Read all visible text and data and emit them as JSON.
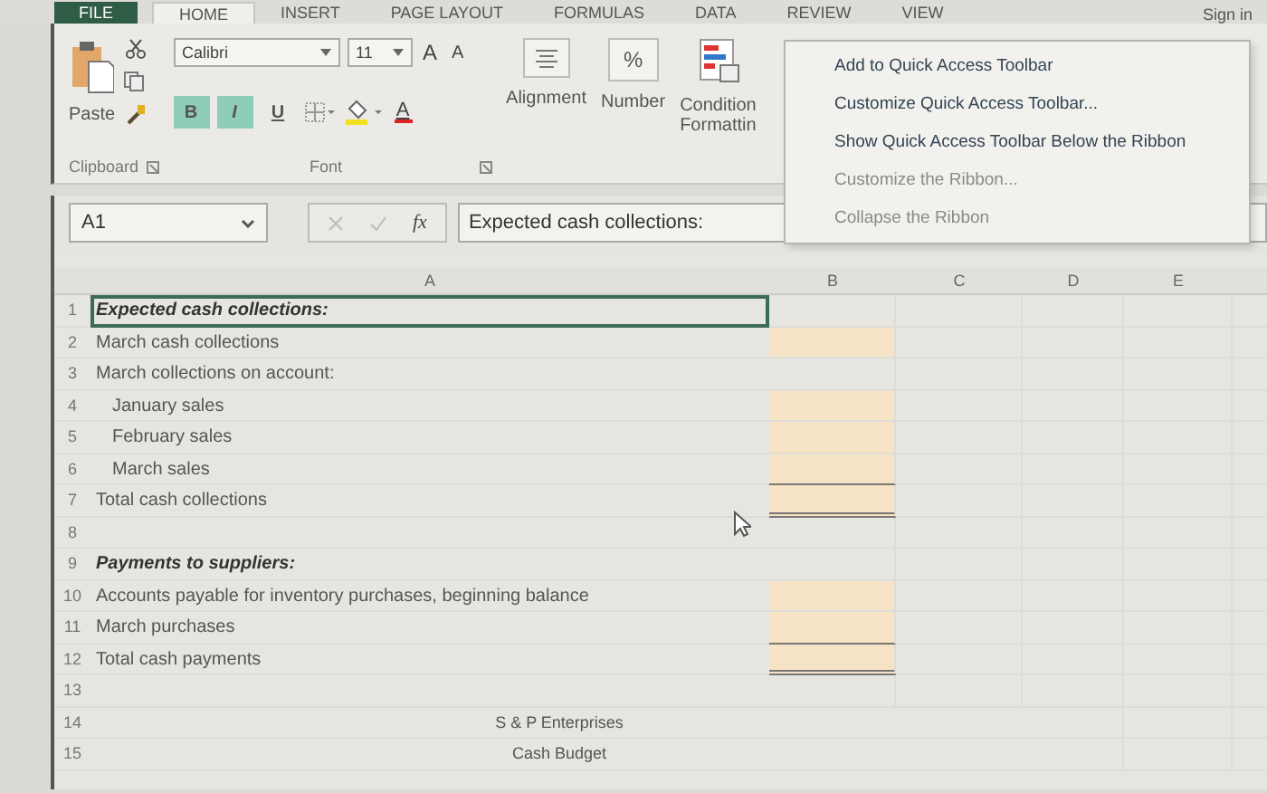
{
  "tabs": [
    {
      "label": "FILE",
      "kind": "file",
      "selected": false
    },
    {
      "label": "HOME",
      "kind": "tab",
      "selected": true
    },
    {
      "label": "INSERT",
      "kind": "tab",
      "selected": false
    },
    {
      "label": "PAGE LAYOUT",
      "kind": "tab",
      "selected": false
    },
    {
      "label": "FORMULAS",
      "kind": "tab",
      "selected": false
    },
    {
      "label": "DATA",
      "kind": "tab",
      "selected": false
    },
    {
      "label": "REVIEW",
      "kind": "tab",
      "selected": false
    },
    {
      "label": "VIEW",
      "kind": "tab",
      "selected": false
    }
  ],
  "sign_in": "Sign in",
  "ribbon": {
    "clipboard": {
      "paste_label": "Paste",
      "group_label": "Clipboard"
    },
    "font": {
      "name": "Calibri",
      "size": "11",
      "grow": "A",
      "shrink": "A",
      "font_color": "A",
      "group_label": "Font",
      "format_buttons": [
        {
          "label": "B",
          "kind": "bold",
          "selected": true
        },
        {
          "label": "I",
          "kind": "italic",
          "selected": true
        },
        {
          "label": "U",
          "kind": "underline",
          "selected": false
        }
      ]
    },
    "alignment": {
      "label": "Alignment"
    },
    "number": {
      "symbol": "%",
      "label": "Number"
    },
    "conditional": {
      "label": "Condition Formattin"
    }
  },
  "context_menu": [
    {
      "label": "Add to Quick Access Toolbar",
      "disabled": false
    },
    {
      "label": "Customize Quick Access Toolbar...",
      "disabled": false
    },
    {
      "label": "Show Quick Access Toolbar Below the Ribbon",
      "disabled": false
    },
    {
      "label": "Customize the Ribbon...",
      "disabled": true
    },
    {
      "label": "Collapse the Ribbon",
      "disabled": true
    }
  ],
  "formula_bar": {
    "name_box": "A1",
    "fx": "fx",
    "content": "Expected cash collections:"
  },
  "sheet": {
    "columns": [
      "A",
      "B",
      "C",
      "D",
      "E"
    ],
    "rows": [
      {
        "number": "1",
        "text": "Expected cash collections:",
        "kind": "heading",
        "selected": true
      },
      {
        "number": "2",
        "text": "March cash collections",
        "kind": "item",
        "input": {
          "kind": "fill"
        },
        "selected": false
      },
      {
        "number": "3",
        "text": "March collections on account:",
        "kind": "item",
        "selected": false
      },
      {
        "number": "4",
        "text": "January sales",
        "kind": "indent",
        "input": {
          "kind": "fill"
        },
        "selected": false
      },
      {
        "number": "5",
        "text": "February sales",
        "kind": "indent",
        "input": {
          "kind": "fill"
        },
        "selected": false
      },
      {
        "number": "6",
        "text": "March sales",
        "kind": "indent",
        "input": {
          "kind": "fill-underline"
        },
        "selected": false
      },
      {
        "number": "7",
        "text": "Total cash collections",
        "kind": "item",
        "input": {
          "kind": "fill-double"
        },
        "selected": false
      },
      {
        "number": "8",
        "kind": "blank",
        "selected": false
      },
      {
        "number": "9",
        "text": "Payments to suppliers:",
        "kind": "heading",
        "selected": false
      },
      {
        "number": "10",
        "text": "Accounts payable for inventory purchases, beginning balance",
        "kind": "item",
        "input": {
          "kind": "fill"
        },
        "selected": false
      },
      {
        "number": "11",
        "text": "March purchases",
        "kind": "item",
        "input": {
          "kind": "fill-underline"
        },
        "selected": false
      },
      {
        "number": "12",
        "text": "Total cash payments",
        "kind": "item",
        "input": {
          "kind": "fill-double"
        },
        "selected": false
      },
      {
        "number": "13",
        "kind": "blank",
        "selected": false
      },
      {
        "number": "14",
        "text": "S & P Enterprises",
        "kind": "title",
        "selected": false
      },
      {
        "number": "15",
        "text": "Cash Budget",
        "kind": "title",
        "selected": false
      }
    ]
  }
}
